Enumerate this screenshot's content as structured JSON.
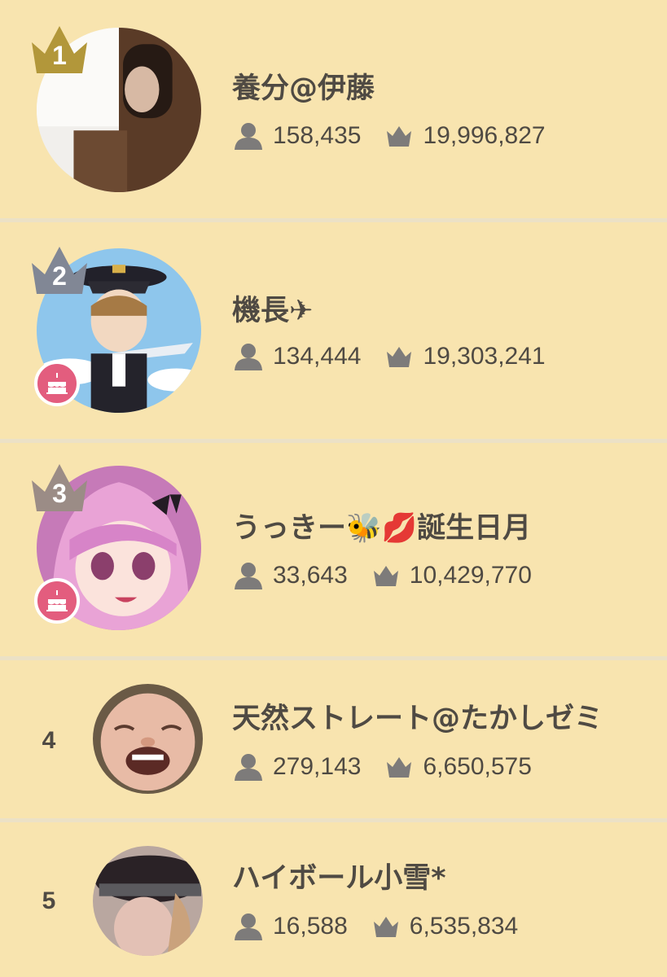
{
  "ranking": [
    {
      "rank": "1",
      "name": "養分@伊藤",
      "followers": "158,435",
      "score": "19,996,827",
      "crown_color": "#b2973a",
      "birthday": false
    },
    {
      "rank": "2",
      "name": "機長✈",
      "followers": "134,444",
      "score": "19,303,241",
      "crown_color": "#818795",
      "birthday": true
    },
    {
      "rank": "3",
      "name": "うっきー🐝💋誕生日月",
      "followers": "33,643",
      "score": "10,429,770",
      "crown_color": "#9b8c86",
      "birthday": true
    },
    {
      "rank": "4",
      "name": "天然ストレート@たかしゼミ",
      "followers": "279,143",
      "score": "6,650,575",
      "birthday": false
    },
    {
      "rank": "5",
      "name": "ハイボール小雪*",
      "followers": "16,588",
      "score": "6,535,834",
      "birthday": false
    }
  ],
  "icons": {
    "followers": "person-icon",
    "score": "crown-icon",
    "birthday": "cake-icon"
  },
  "colors": {
    "background": "#f8e4af",
    "text": "#4f4a43",
    "icon": "#7d7b7a",
    "birthday_badge": "#e35d7e"
  }
}
